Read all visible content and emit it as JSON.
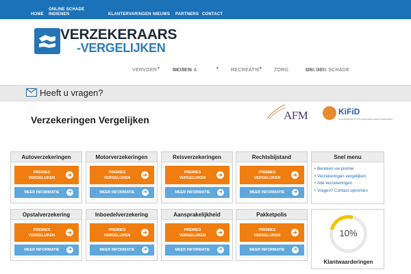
{
  "topnav": {
    "items": [
      "Home",
      "Online schade indienen",
      "Klantervaringen",
      "Nieuws",
      "Partners",
      "Contact"
    ]
  },
  "logo": {
    "line1": "VERZEKERAARS",
    "line2": "-VERGELIJKEN"
  },
  "mainmenu": {
    "items": [
      "Vervoer",
      "Wonen &",
      "Recreatie",
      "Zorg",
      "Melden schade"
    ],
    "overlap": [
      "Reizen",
      "Online"
    ]
  },
  "contact_band": {
    "text": "Heeft u vragen?"
  },
  "page_title": "Verzekeringen Vergelijken",
  "partners": {
    "afm": "AFM",
    "kifid": "KiFiD",
    "kifid_sub": "KLACHTENINSTITUUT FINANCIËLE DIENSTVERLENING"
  },
  "buttons": {
    "primary": "Premies vergelijken",
    "secondary": "Meer informatie"
  },
  "products": [
    "Autoverzekeringen",
    "Motorverzekeringen",
    "Reisverzekeringen",
    "Rechtsbijstand",
    "Opstalverzekering",
    "Inboedelverzekering",
    "Aansprakelijkheid",
    "Pakketpolis"
  ],
  "snel_menu": {
    "title": "Snel menu",
    "items": [
      "Bereken uw premie",
      "Verzekeringen vergelijken",
      "Alle verzekeringen",
      "Vragen? Contact opnemen"
    ]
  },
  "rating": {
    "value": "10%",
    "fraction": 0.1,
    "label": "Klantwaarderingen"
  },
  "colors": {
    "primary_blue": "#1b72b8",
    "orange": "#f07d0f",
    "light_blue": "#5fa8dd"
  }
}
